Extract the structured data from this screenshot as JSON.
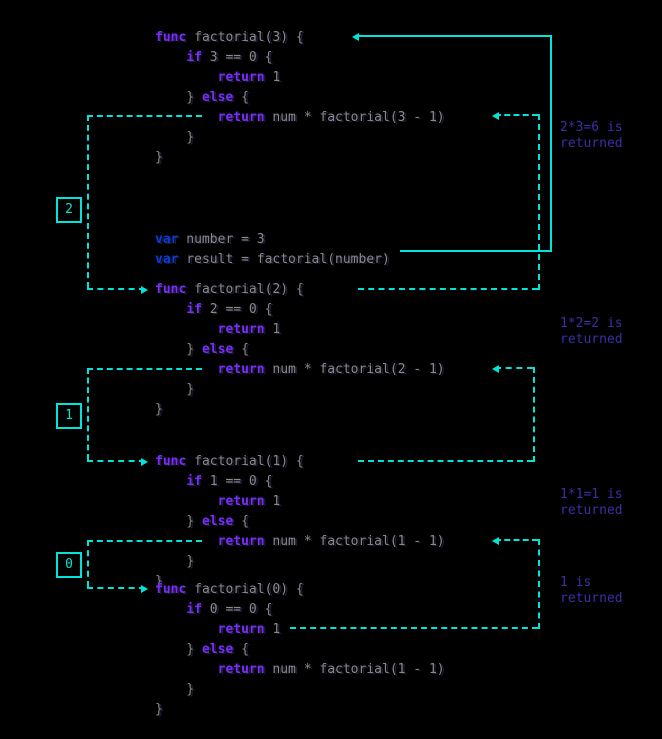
{
  "blocks": [
    {
      "n": "3",
      "lines": [
        [
          [
            "kw",
            "func"
          ],
          [
            "base",
            " factorial(3) {"
          ]
        ],
        [
          [
            "base",
            "    "
          ],
          [
            "kw",
            "if"
          ],
          [
            "base",
            " 3 == 0 {"
          ]
        ],
        [
          [
            "base",
            "        "
          ],
          [
            "kw",
            "return"
          ],
          [
            "base",
            " 1"
          ]
        ],
        [
          [
            "base",
            "    } "
          ],
          [
            "kw",
            "else"
          ],
          [
            "base",
            " {"
          ]
        ],
        [
          [
            "base",
            "        "
          ],
          [
            "kw",
            "return"
          ],
          [
            "base",
            " num * factorial(3 - 1)"
          ]
        ],
        [
          [
            "base",
            "    }"
          ]
        ],
        [
          [
            "base",
            "}"
          ]
        ]
      ]
    },
    {
      "n": "init",
      "lines": [
        [
          [
            "kw2",
            "var"
          ],
          [
            "base",
            " number = 3"
          ]
        ],
        [
          [
            "kw2",
            "var"
          ],
          [
            "base",
            " result = factorial(number)"
          ]
        ]
      ]
    },
    {
      "n": "2",
      "lines": [
        [
          [
            "kw",
            "func"
          ],
          [
            "base",
            " factorial(2) {"
          ]
        ],
        [
          [
            "base",
            "    "
          ],
          [
            "kw",
            "if"
          ],
          [
            "base",
            " 2 == 0 {"
          ]
        ],
        [
          [
            "base",
            "        "
          ],
          [
            "kw",
            "return"
          ],
          [
            "base",
            " 1"
          ]
        ],
        [
          [
            "base",
            "    } "
          ],
          [
            "kw",
            "else"
          ],
          [
            "base",
            " {"
          ]
        ],
        [
          [
            "base",
            "        "
          ],
          [
            "kw",
            "return"
          ],
          [
            "base",
            " num * factorial(2 - 1)"
          ]
        ],
        [
          [
            "base",
            "    }"
          ]
        ],
        [
          [
            "base",
            "}"
          ]
        ]
      ]
    },
    {
      "n": "1",
      "lines": [
        [
          [
            "kw",
            "func"
          ],
          [
            "base",
            " factorial(1) {"
          ]
        ],
        [
          [
            "base",
            "    "
          ],
          [
            "kw",
            "if"
          ],
          [
            "base",
            " 1 == 0 {"
          ]
        ],
        [
          [
            "base",
            "        "
          ],
          [
            "kw",
            "return"
          ],
          [
            "base",
            " 1"
          ]
        ],
        [
          [
            "base",
            "    } "
          ],
          [
            "kw",
            "else"
          ],
          [
            "base",
            " {"
          ]
        ],
        [
          [
            "base",
            "        "
          ],
          [
            "kw",
            "return"
          ],
          [
            "base",
            " num * factorial(1 - 1)"
          ]
        ],
        [
          [
            "base",
            "    }"
          ]
        ],
        [
          [
            "base",
            "}"
          ]
        ]
      ]
    },
    {
      "n": "0",
      "lines": [
        [
          [
            "kw",
            "func"
          ],
          [
            "base",
            " factorial(0) {"
          ]
        ],
        [
          [
            "base",
            "    "
          ],
          [
            "kw",
            "if"
          ],
          [
            "base",
            " 0 == 0 {"
          ]
        ],
        [
          [
            "base",
            "        "
          ],
          [
            "kw",
            "return"
          ],
          [
            "base",
            " 1"
          ]
        ],
        [
          [
            "base",
            "    } "
          ],
          [
            "kw",
            "else"
          ],
          [
            "base",
            " {"
          ]
        ],
        [
          [
            "base",
            "        "
          ],
          [
            "kw",
            "return"
          ],
          [
            "base",
            " num * factorial(1 - 1)"
          ]
        ],
        [
          [
            "base",
            "    }"
          ]
        ],
        [
          [
            "base",
            "}"
          ]
        ]
      ]
    }
  ],
  "notes": {
    "r3": "2*3=6 is\nreturned",
    "r2": "1*2=2 is\nreturned",
    "r1": "1*1=1 is\nreturned",
    "r0": "1 is\nreturned"
  },
  "badges": {
    "b2": "2",
    "b1": "1",
    "b0": "0"
  }
}
